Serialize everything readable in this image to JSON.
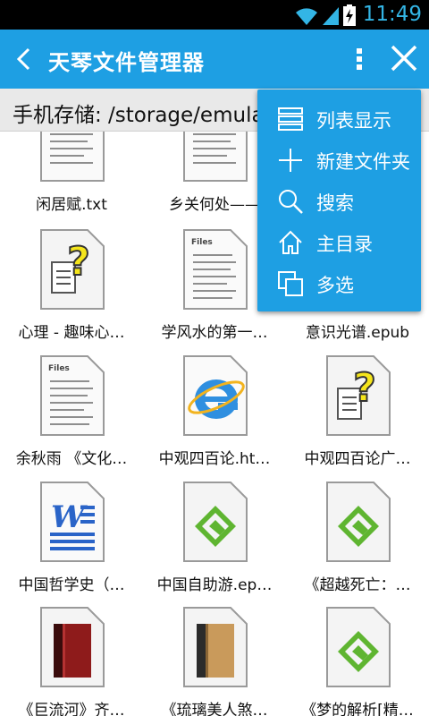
{
  "status_bar": {
    "time": "11:49"
  },
  "action_bar": {
    "title": "天琴文件管理器"
  },
  "path_bar": {
    "path": "手机存储: /storage/emula"
  },
  "menu": {
    "items": [
      {
        "label": "列表显示",
        "icon": "list-view-icon"
      },
      {
        "label": "新建文件夹",
        "icon": "plus-icon"
      },
      {
        "label": "搜索",
        "icon": "search-icon"
      },
      {
        "label": "主目录",
        "icon": "home-icon"
      },
      {
        "label": "多选",
        "icon": "multi-select-icon"
      }
    ]
  },
  "files": [
    {
      "name": "闲居赋.txt",
      "icon": "text-file-icon"
    },
    {
      "name": "乡关何处——",
      "icon": "text-file-icon"
    },
    {
      "name": "",
      "icon": "text-file-icon"
    },
    {
      "name": "心理 - 趣味心…",
      "icon": "unknown-file-icon"
    },
    {
      "name": "学风水的第一…",
      "icon": "text-file-icon"
    },
    {
      "name": "意识光谱.epub",
      "icon": "epub-icon"
    },
    {
      "name": "余秋雨 《文化…",
      "icon": "text-file-icon"
    },
    {
      "name": "中观四百论.ht…",
      "icon": "html-file-icon"
    },
    {
      "name": "中观四百论广…",
      "icon": "unknown-file-icon"
    },
    {
      "name": "中国哲学史（…",
      "icon": "word-doc-icon"
    },
    {
      "name": "中国自助游.ep…",
      "icon": "epub-icon"
    },
    {
      "name": "《超越死亡：…",
      "icon": "epub-icon"
    },
    {
      "name": "《巨流河》齐…",
      "icon": "red-book-icon"
    },
    {
      "name": "《琉璃美人煞…",
      "icon": "brown-book-icon"
    },
    {
      "name": "《梦的解析[精…",
      "icon": "epub-icon"
    }
  ],
  "colors": {
    "accent": "#1e9fe3",
    "path_bar": "#e9e9e9",
    "time": "#33b5e5"
  }
}
